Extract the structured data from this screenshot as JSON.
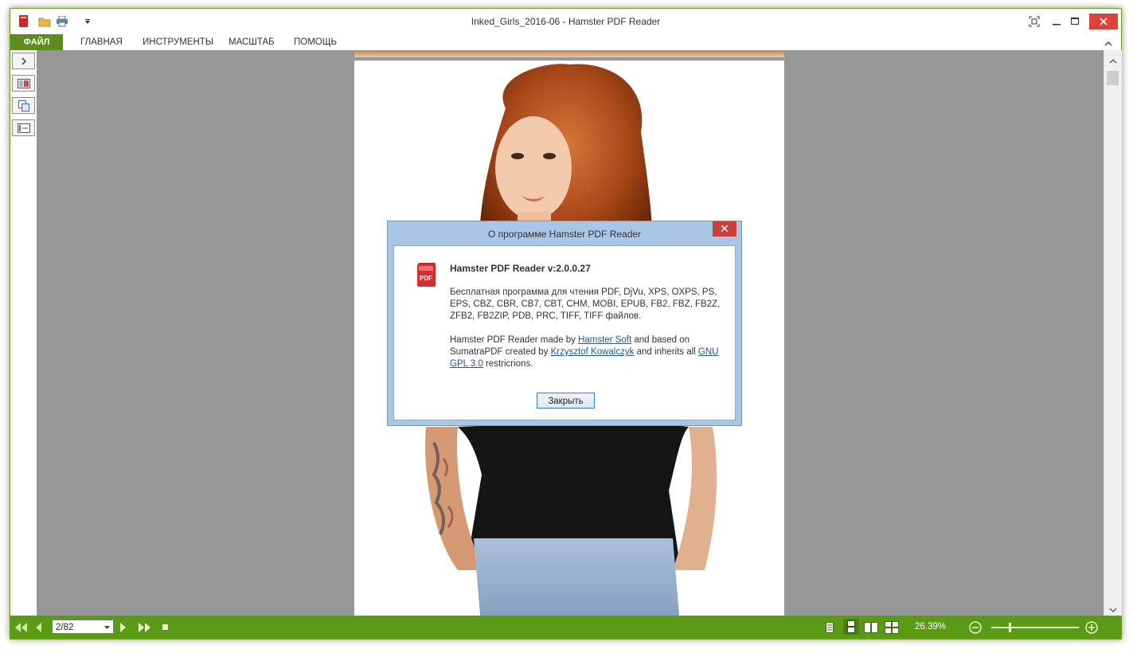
{
  "window": {
    "title": "Inked_Girls_2016-06 - Hamster PDF Reader"
  },
  "ribbon": {
    "tabs": [
      "ФАЙЛ",
      "ГЛАВНАЯ",
      "ИНСТРУМЕНТЫ",
      "МАСШТАБ",
      "ПОМОЩЬ"
    ]
  },
  "dialog": {
    "title": "О программе Hamster PDF Reader",
    "close_glyph": "✕",
    "heading": "Hamster PDF Reader v:2.0.0.27",
    "desc": "Бесплатная программа для чтения PDF, DjVu, XPS, OXPS, PS, EPS, CBZ, CBR, CB7, CBT, CHM, MOBI, EPUB, FB2, FBZ, FB2Z, ZFB2, FB2ZIP, PDB, PRC, TIFF, TIFF файлов.",
    "credits_1": "Hamster PDF Reader made by ",
    "link_hamster": "Hamster Soft",
    "credits_2": " and based on SumatraPDF created by ",
    "link_author": "Krzysztof Kowalczyk",
    "credits_3": " and inherits all ",
    "link_gpl": "GNU GPL 3.0",
    "credits_4": " restricrions.",
    "close_button": "Закрыть"
  },
  "statusbar": {
    "page_indicator": "2/82",
    "zoom": "26.39%",
    "zoom_level": 0.2
  },
  "colors": {
    "accent_green": "#5a9a14",
    "file_tab": "#5e8c1e",
    "close_red": "#d9453d",
    "viewer_bg": "#979797"
  }
}
